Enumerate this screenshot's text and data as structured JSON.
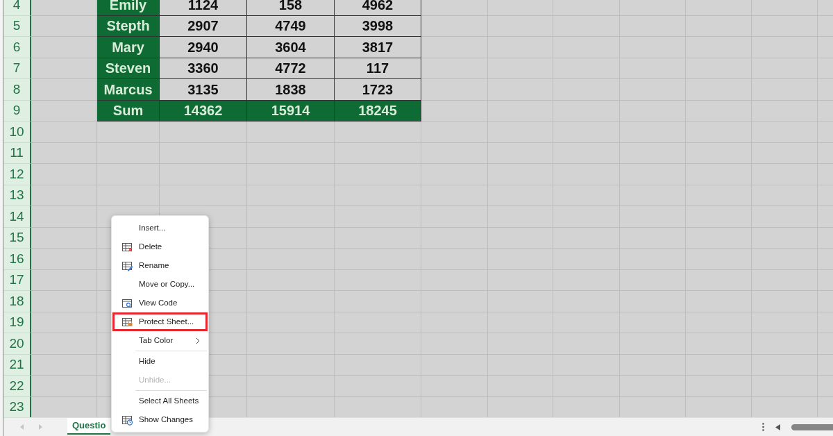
{
  "grid": {
    "rows": [
      {
        "number": "4",
        "selected": true,
        "cells": [
          "Emily",
          "1124",
          "158",
          "4962"
        ]
      },
      {
        "number": "5",
        "selected": true,
        "cells": [
          "Stepth",
          "2907",
          "4749",
          "3998"
        ]
      },
      {
        "number": "6",
        "selected": true,
        "cells": [
          "Mary",
          "2940",
          "3604",
          "3817"
        ]
      },
      {
        "number": "7",
        "selected": true,
        "cells": [
          "Steven",
          "3360",
          "4772",
          "117"
        ]
      },
      {
        "number": "8",
        "selected": true,
        "cells": [
          "Marcus",
          "3135",
          "1838",
          "1723"
        ]
      },
      {
        "number": "9",
        "selected": true,
        "kind": "sum",
        "cells": [
          "Sum",
          "14362",
          "15914",
          "18245"
        ]
      },
      {
        "number": "10",
        "selected": true
      },
      {
        "number": "11",
        "selected": true
      },
      {
        "number": "12",
        "selected": true
      },
      {
        "number": "13",
        "selected": true
      },
      {
        "number": "14",
        "selected": true
      },
      {
        "number": "15",
        "selected": true
      },
      {
        "number": "16",
        "selected": true
      },
      {
        "number": "17",
        "selected": true
      },
      {
        "number": "18",
        "selected": true
      },
      {
        "number": "19",
        "selected": true
      },
      {
        "number": "20",
        "selected": true
      },
      {
        "number": "21",
        "selected": true
      },
      {
        "number": "22",
        "selected": true
      },
      {
        "number": "23",
        "selected": true
      }
    ]
  },
  "context_menu": {
    "items": [
      {
        "label": "Insert...",
        "kind": "plain",
        "disabled": false,
        "highlighted": false
      },
      {
        "label": "Delete",
        "kind": "delete",
        "disabled": false,
        "highlighted": false
      },
      {
        "label": "Rename",
        "kind": "rename",
        "disabled": false,
        "highlighted": false
      },
      {
        "label": "Move or Copy...",
        "kind": "plain",
        "disabled": false,
        "highlighted": false
      },
      {
        "label": "View Code",
        "kind": "code",
        "disabled": false,
        "highlighted": false
      },
      {
        "label": "Protect Sheet...",
        "kind": "protect",
        "disabled": false,
        "highlighted": true
      },
      {
        "label": "Tab Color",
        "kind": "plain",
        "disabled": false,
        "highlighted": false,
        "submenu": true
      },
      {
        "label": "Hide",
        "kind": "plain",
        "disabled": false,
        "highlighted": false,
        "separator_before": true
      },
      {
        "label": "Unhide...",
        "kind": "plain",
        "disabled": true,
        "highlighted": false
      },
      {
        "label": "Select All Sheets",
        "kind": "plain",
        "disabled": false,
        "highlighted": false,
        "separator_before": true
      },
      {
        "label": "Show Changes",
        "kind": "changes",
        "disabled": false,
        "highlighted": false
      }
    ]
  },
  "sheet_tabs": [
    {
      "label": "Questio",
      "selected": true
    }
  ]
}
